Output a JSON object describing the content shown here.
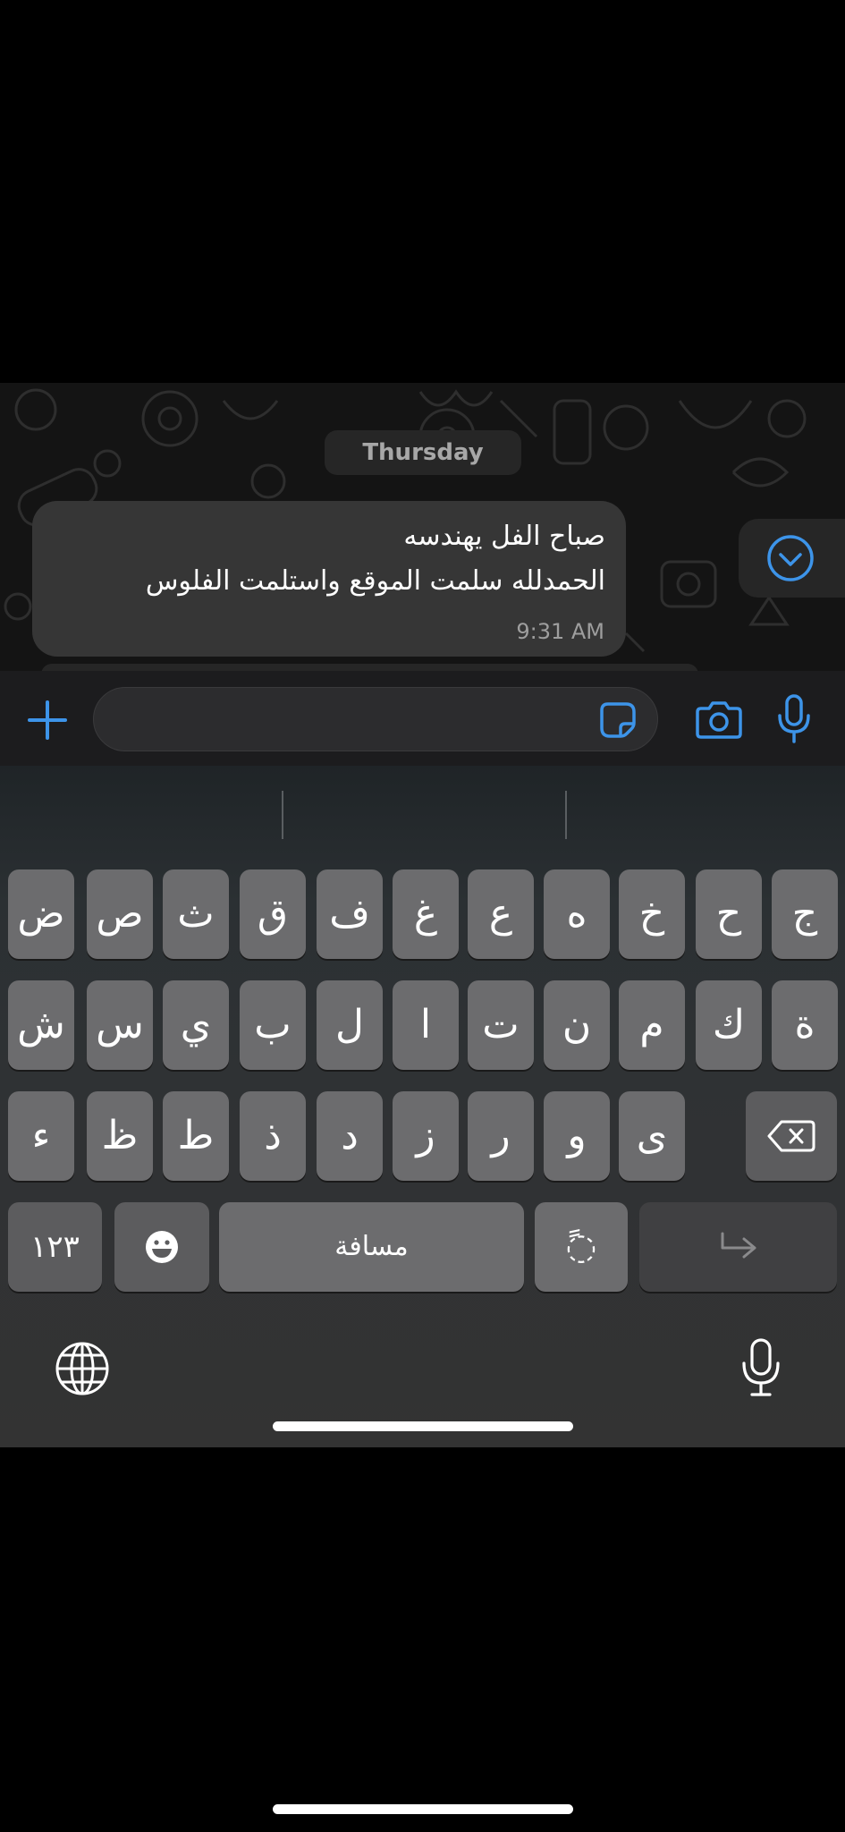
{
  "chat": {
    "date_label": "Thursday",
    "message": {
      "line1": "صباح الفل يهندسه",
      "line2": "الحمدلله سلمت الموقع واستلمت الفلوس",
      "time": "9:31 AM"
    }
  },
  "input_bar": {
    "icons": [
      "plus-icon",
      "sticker-icon",
      "camera-icon",
      "microphone-icon"
    ]
  },
  "keyboard": {
    "row1": [
      "ض",
      "ص",
      "ث",
      "ق",
      "ف",
      "غ",
      "ع",
      "ه",
      "خ",
      "ح",
      "ج"
    ],
    "row2": [
      "ش",
      "س",
      "ي",
      "ب",
      "ل",
      "ا",
      "ت",
      "ن",
      "م",
      "ك",
      "ة"
    ],
    "row3": [
      "ء",
      "ظ",
      "ط",
      "ذ",
      "د",
      "ز",
      "ر",
      "و",
      "ى"
    ],
    "numbers_label": "١٢٣",
    "space_label": "مسافة",
    "diacritic_label": "ً◌",
    "accent_color": "#3d94e9"
  }
}
